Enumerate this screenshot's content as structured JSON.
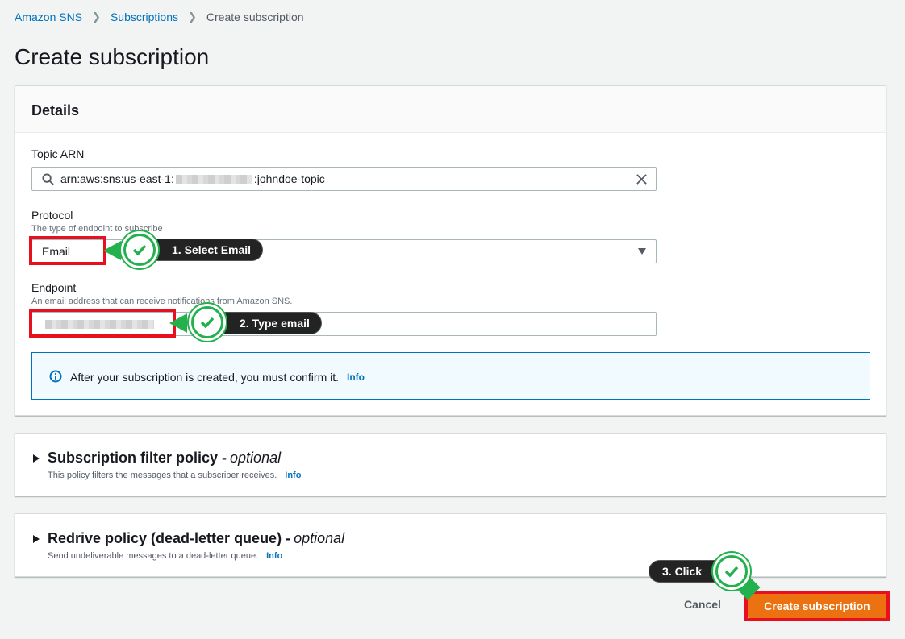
{
  "breadcrumb": {
    "items": [
      "Amazon SNS",
      "Subscriptions"
    ],
    "current": "Create subscription"
  },
  "page": {
    "title": "Create subscription"
  },
  "details": {
    "title": "Details",
    "topic_arn": {
      "label": "Topic ARN",
      "value_prefix": "arn:aws:sns:us-east-1:",
      "value_suffix": ":johndoe-topic"
    },
    "protocol": {
      "label": "Protocol",
      "description": "The type of endpoint to subscribe",
      "value": "Email"
    },
    "endpoint": {
      "label": "Endpoint",
      "description": "An email address that can receive notifications from Amazon SNS."
    },
    "alert": {
      "text": "After your subscription is created, you must confirm it.",
      "info": "Info"
    }
  },
  "filter_policy": {
    "title": "Subscription filter policy -",
    "optional": "optional",
    "description": "This policy filters the messages that a subscriber receives.",
    "info": "Info"
  },
  "redrive_policy": {
    "title": "Redrive policy (dead-letter queue) -",
    "optional": "optional",
    "description": "Send undeliverable messages to a dead-letter queue.",
    "info": "Info"
  },
  "actions": {
    "cancel": "Cancel",
    "create": "Create subscription"
  },
  "annotations": {
    "step1": "1. Select Email",
    "step2": "2. Type email",
    "step3": "3. Click"
  },
  "colors": {
    "primary": "#ec7211",
    "link": "#0073bb",
    "highlight": "#e8101f",
    "check": "#23b14d"
  },
  "icons": [
    "search-icon",
    "clear-icon",
    "dropdown-arrow-icon",
    "info-icon",
    "caret-right-icon",
    "checkmark-icon"
  ]
}
